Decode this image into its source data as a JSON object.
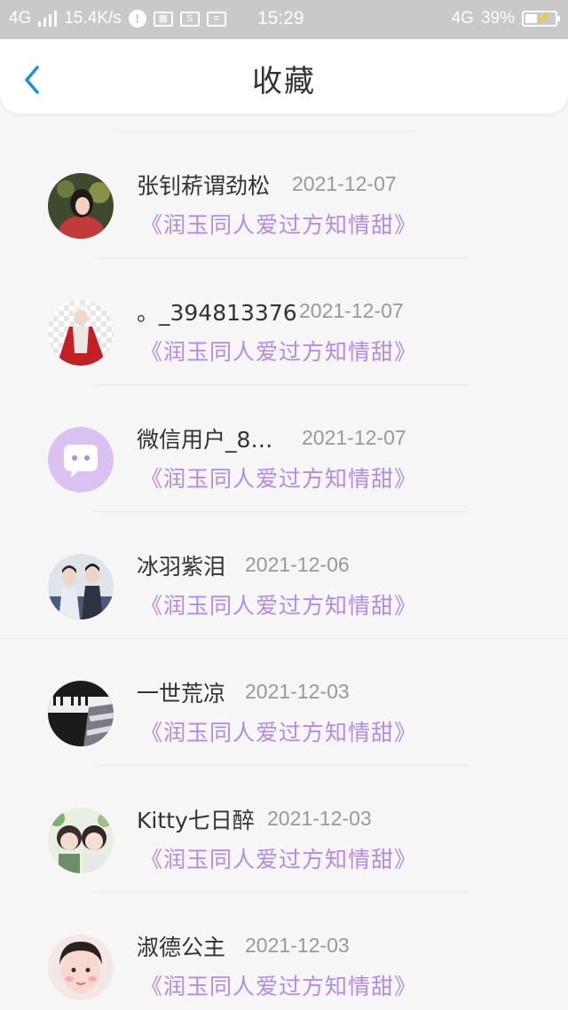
{
  "status_bar": {
    "network_left": "4G",
    "speed": "15.4K/s",
    "time": "15:29",
    "network_right": "4G",
    "battery": "39%"
  },
  "header": {
    "title": "收藏"
  },
  "items": [
    {
      "name": "张钊菥谓劲松",
      "date": "2021-12-07",
      "work": "《润玉同人爱过方知情甜》",
      "avatar": "girl-photo-icon"
    },
    {
      "name": "。_394813376",
      "date": "2021-12-07",
      "work": "《润玉同人爱过方知情甜》",
      "avatar": "red-robe-figure-icon"
    },
    {
      "name": "微信用户_8…",
      "date": "2021-12-07",
      "work": "《润玉同人爱过方知情甜》",
      "avatar": "default-chat-bubble-icon"
    },
    {
      "name": "冰羽紫泪",
      "date": "2021-12-06",
      "work": "《润玉同人爱过方知情甜》",
      "avatar": "couple-photo-icon"
    },
    {
      "name": "一世荒凉",
      "date": "2021-12-03",
      "work": "《润玉同人爱过方知情甜》",
      "avatar": "piano-photo-icon"
    },
    {
      "name": "Kitty七日醉",
      "date": "2021-12-03",
      "work": "《润玉同人爱过方知情甜》",
      "avatar": "chibi-characters-icon"
    },
    {
      "name": "淑德公主",
      "date": "2021-12-03",
      "work": "《润玉同人爱过方知情甜》",
      "avatar": "child-photo-icon"
    }
  ],
  "colors": {
    "accent": "#1e8fe6",
    "work_title": "#b58be6",
    "default_avatar": "#d9c2f2"
  }
}
